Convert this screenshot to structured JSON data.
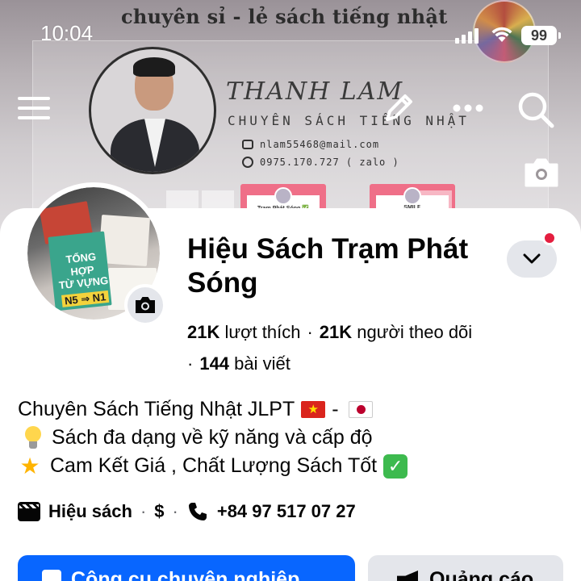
{
  "status_bar": {
    "time": "10:04",
    "battery": "99"
  },
  "cover": {
    "heading": "chuyên sỉ - lẻ sách tiếng nhật",
    "signature": "THANH LAM",
    "tagline": "CHUYÊN SÁCH TIẾNG NHẬT",
    "email": "nlam55468@mail.com",
    "phone": "0975.170.727 ( zalo )",
    "tile_label": "Trạm Phát Sóng ✅",
    "tile_label_2": "SMILE"
  },
  "avatar_art": {
    "line1": "TỔNG HỢP",
    "line2": "TỪ VỰNG",
    "line3": "N5 ⇒ N1"
  },
  "page": {
    "name": "Hiệu Sách Trạm Phát Sóng",
    "likes_count": "21K",
    "likes_label": "lượt thích",
    "followers_count": "21K",
    "followers_label": "người theo dõi",
    "posts_count": "144",
    "posts_label": "bài viết"
  },
  "bio": {
    "line1_text": "Chuyên Sách Tiếng Nhật JLPT",
    "line1_sep": "-",
    "line2_text": "Sách đa dạng về kỹ năng và cấp độ",
    "line3_text": "Cam Kết Giá , Chất Lượng Sách Tốt"
  },
  "info": {
    "category": "Hiệu sách",
    "price": "$",
    "phone": "+84 97 517 07 27"
  },
  "buttons": {
    "primary": "Công cụ chuyên nghiệp",
    "secondary": "Quảng cáo"
  },
  "colors": {
    "primary": "#0866ff",
    "secondary_bg": "#e4e6eb",
    "notification": "#e41e3f"
  }
}
